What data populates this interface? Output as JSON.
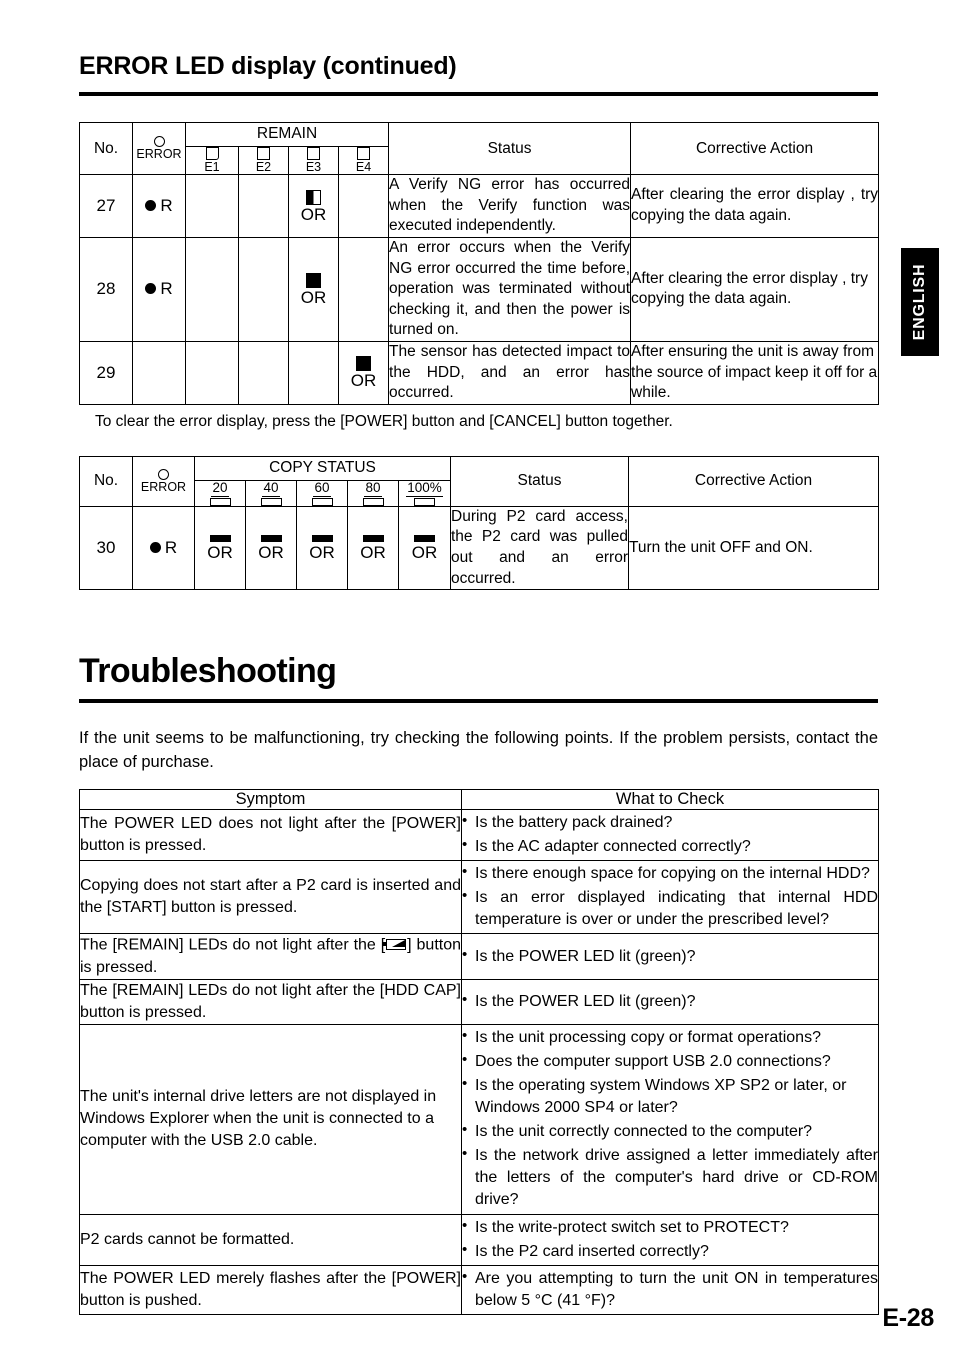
{
  "page": {
    "section_title": "ERROR LED display (continued)",
    "page_number": "E-28",
    "side_tab": "ENGLISH"
  },
  "error_table": {
    "headers": {
      "no": "No.",
      "error": "ERROR",
      "remain": "REMAIN",
      "status": "Status",
      "corrective_action": "Corrective Action",
      "leds": [
        "E1",
        "E2",
        "E3",
        "E4"
      ]
    },
    "rows": [
      {
        "no": "27",
        "error": "R",
        "error_on": true,
        "leds": [
          "",
          "",
          "half",
          ""
        ],
        "or_labels": [
          "",
          "",
          "OR",
          ""
        ],
        "status": "A Verify NG error has occurred when the Verify function was executed independently.",
        "corrective_action": "After clearing the error display , try copying the data again."
      },
      {
        "no": "28",
        "error": "R",
        "error_on": true,
        "leds": [
          "",
          "",
          "full",
          ""
        ],
        "or_labels": [
          "",
          "",
          "OR",
          ""
        ],
        "status": "An error occurs when the Verify NG error occurred the time before, operation was terminated without checking it, and then the power is turned on.",
        "corrective_action": "After clearing the error display , try copying the data again."
      },
      {
        "no": "29",
        "error": "",
        "error_on": false,
        "leds": [
          "",
          "",
          "",
          "full"
        ],
        "or_labels": [
          "",
          "",
          "",
          "OR"
        ],
        "status": "The sensor has detected impact to the HDD, and an error has occurred.",
        "corrective_action": "After ensuring the unit is away from the source of impact keep it off for a while."
      }
    ],
    "note": "To clear the error display, press the [POWER] button and [CANCEL] button together."
  },
  "copy_table": {
    "headers": {
      "no": "No.",
      "error": "ERROR",
      "copy_status": "COPY STATUS",
      "status": "Status",
      "corrective_action": "Corrective Action",
      "leds": [
        "20",
        "40",
        "60",
        "80",
        "100%"
      ]
    },
    "rows": [
      {
        "no": "30",
        "error": "R",
        "error_on": true,
        "bars": [
          "bar",
          "bar",
          "bar",
          "bar",
          "bar"
        ],
        "or_labels": [
          "OR",
          "OR",
          "OR",
          "OR",
          "OR"
        ],
        "status": "During P2 card access, the P2 card was pulled out and an error occurred.",
        "corrective_action": "Turn the unit OFF and ON."
      }
    ]
  },
  "troubleshooting": {
    "title": "Troubleshooting",
    "intro": "If the unit seems to be malfunctioning, try checking the following points. If the problem persists, contact the place of purchase.",
    "headers": {
      "symptom": "Symptom",
      "what_to_check": "What to Check"
    },
    "rows": [
      {
        "symptom_pre": "The POWER LED does not light after the [POWER] button is pressed.",
        "symptom_post": "",
        "has_icon": false,
        "checks": [
          "Is the battery pack drained?",
          "Is the AC adapter connected correctly?"
        ]
      },
      {
        "symptom_pre": "Copying does not start after a P2 card is inserted and the [START] button is pressed.",
        "symptom_post": "",
        "has_icon": false,
        "checks": [
          "Is there enough space for copying on the internal HDD?",
          "Is an error displayed indicating that internal HDD temperature is over or under the prescribed level?"
        ]
      },
      {
        "symptom_pre": "The [REMAIN] LEDs do not light after the [",
        "symptom_post": "] button is pressed.",
        "has_icon": true,
        "icon": "battery-level-icon",
        "checks": [
          "Is the POWER LED lit (green)?"
        ]
      },
      {
        "symptom_pre": "The [REMAIN] LEDs do not light after the [HDD CAP] button is pressed.",
        "symptom_post": "",
        "has_icon": false,
        "checks": [
          "Is the POWER LED lit (green)?"
        ]
      },
      {
        "symptom_pre": "The unit's internal drive letters are not displayed in Windows Explorer when the unit is connected to a computer with the USB 2.0 cable.",
        "symptom_post": "",
        "has_icon": false,
        "checks": [
          "Is the unit processing copy or format operations?",
          "Does the computer support USB 2.0 connections?",
          "Is the operating system Windows XP SP2 or later, or Windows 2000 SP4 or later?",
          "Is the unit correctly connected to the computer?",
          "Is the network drive assigned a letter immediately after the letters of the computer's hard drive or CD-ROM drive?"
        ]
      },
      {
        "symptom_pre": "P2 cards cannot be formatted.",
        "symptom_post": "",
        "has_icon": false,
        "checks": [
          "Is the write-protect switch set to PROTECT?",
          "Is the P2 card inserted correctly?"
        ]
      },
      {
        "symptom_pre": "The POWER LED merely flashes after the [POWER] button is pushed.",
        "symptom_post": "",
        "has_icon": false,
        "checks": [
          "Are you attempting to turn the unit ON in temperatures below 5 °C (41 °F)?"
        ]
      }
    ]
  }
}
